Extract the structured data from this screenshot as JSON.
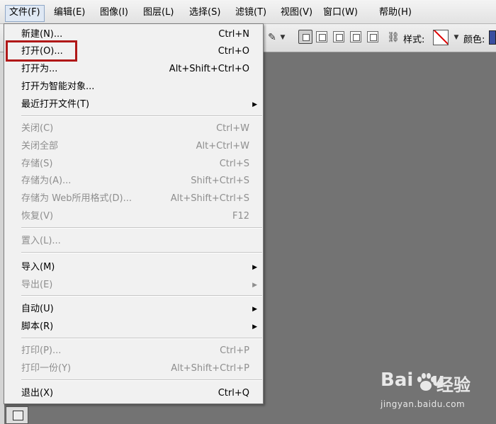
{
  "menubar": {
    "items": [
      {
        "label": "文件(F)",
        "active": true
      },
      {
        "label": "编辑(E)"
      },
      {
        "label": "图像(I)"
      },
      {
        "label": "图层(L)"
      },
      {
        "label": "选择(S)"
      },
      {
        "label": "滤镜(T)"
      },
      {
        "label": "视图(V)"
      },
      {
        "label": "窗口(W)"
      },
      {
        "label": "帮助(H)"
      }
    ]
  },
  "options_bar": {
    "style_label": "样式:",
    "color_label": "颜色:",
    "style_swatch": "none",
    "color_swatch_hex": "#3a4fa0"
  },
  "file_menu": {
    "highlighted_item": "打开(O)...",
    "highlight_color": "#b01818",
    "items": [
      {
        "label": "新建(N)...",
        "shortcut": "Ctrl+N",
        "enabled": true
      },
      {
        "label": "打开(O)...",
        "shortcut": "Ctrl+O",
        "enabled": true
      },
      {
        "label": "打开为...",
        "shortcut": "Alt+Shift+Ctrl+O",
        "enabled": true
      },
      {
        "label": "打开为智能对象...",
        "shortcut": "",
        "enabled": true
      },
      {
        "label": "最近打开文件(T)",
        "shortcut": "",
        "enabled": true,
        "submenu": true
      },
      {
        "label": "关闭(C)",
        "shortcut": "Ctrl+W",
        "enabled": false
      },
      {
        "label": "关闭全部",
        "shortcut": "Alt+Ctrl+W",
        "enabled": false
      },
      {
        "label": "存储(S)",
        "shortcut": "Ctrl+S",
        "enabled": false
      },
      {
        "label": "存储为(A)...",
        "shortcut": "Shift+Ctrl+S",
        "enabled": false
      },
      {
        "label": "存储为 Web所用格式(D)...",
        "shortcut": "Alt+Shift+Ctrl+S",
        "enabled": false
      },
      {
        "label": "恢复(V)",
        "shortcut": "F12",
        "enabled": false
      },
      {
        "label": "置入(L)...",
        "shortcut": "",
        "enabled": false
      },
      {
        "label": "导入(M)",
        "shortcut": "",
        "enabled": true,
        "submenu": true
      },
      {
        "label": "导出(E)",
        "shortcut": "",
        "enabled": false,
        "submenu": true
      },
      {
        "label": "自动(U)",
        "shortcut": "",
        "enabled": true,
        "submenu": true
      },
      {
        "label": "脚本(R)",
        "shortcut": "",
        "enabled": true,
        "submenu": true
      },
      {
        "label": "打印(P)...",
        "shortcut": "Ctrl+P",
        "enabled": false
      },
      {
        "label": "打印一份(Y)",
        "shortcut": "Alt+Shift+Ctrl+P",
        "enabled": false
      },
      {
        "label": "退出(X)",
        "shortcut": "Ctrl+Q",
        "enabled": true
      }
    ]
  },
  "watermark": {
    "logo_text": "Bai",
    "logo_cn": "经验",
    "url": "jingyan.baidu.com"
  },
  "icons": {
    "submenu_arrow": "▶",
    "brush": "brush-icon",
    "link": "link-icon"
  }
}
